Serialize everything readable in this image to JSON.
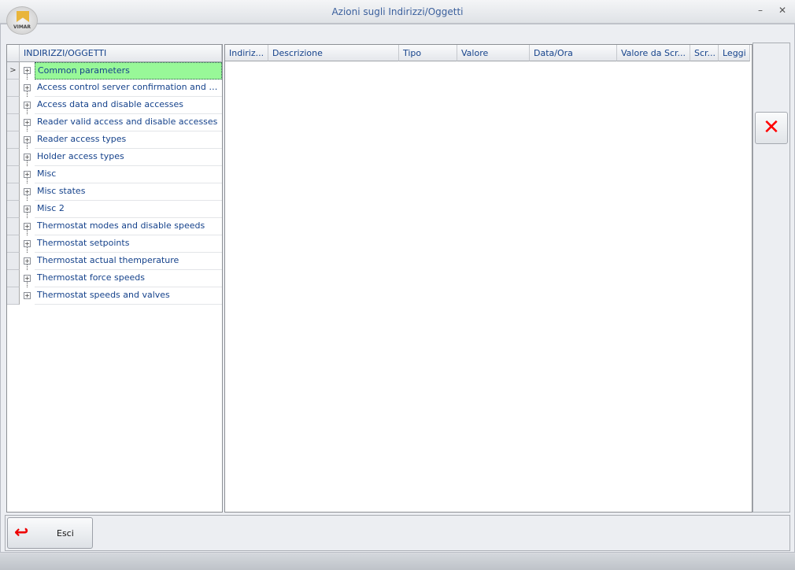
{
  "window": {
    "title": "Azioni sugli Indirizzi/Oggetti",
    "logo_text": "VIMAR",
    "minimize": "–",
    "close": "✕"
  },
  "tree": {
    "header": "INDIRIZZI/OGGETTI",
    "items": [
      {
        "label": "Common parameters",
        "selected": true
      },
      {
        "label": "Access control server confirmation and t..."
      },
      {
        "label": "Access data and disable accesses"
      },
      {
        "label": "Reader valid access and disable accesses"
      },
      {
        "label": "Reader access types"
      },
      {
        "label": "Holder access types"
      },
      {
        "label": "Misc"
      },
      {
        "label": "Misc states"
      },
      {
        "label": "Misc 2"
      },
      {
        "label": "Thermostat modes and disable speeds"
      },
      {
        "label": "Thermostat setpoints"
      },
      {
        "label": "Thermostat actual themperature"
      },
      {
        "label": "Thermostat force speeds"
      },
      {
        "label": "Thermostat speeds and valves"
      }
    ]
  },
  "grid": {
    "columns": [
      "Indiriz...",
      "Descrizione",
      "Tipo",
      "Valore",
      "Data/Ora",
      "Valore da Scr...",
      "Scr...",
      "Leggi"
    ]
  },
  "buttons": {
    "delete_icon": "✕",
    "exit_label": "Esci",
    "exit_icon": "↩"
  }
}
